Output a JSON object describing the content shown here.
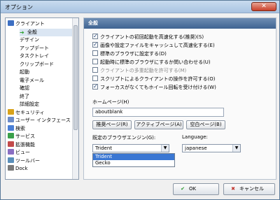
{
  "window": {
    "title": "オプション",
    "close_glyph": "✕"
  },
  "sidebar": {
    "items": [
      {
        "label": "クライアント",
        "level": 0,
        "icon": "client-icon",
        "color": "#3d6fc2"
      },
      {
        "label": "全般",
        "level": 1,
        "icon": "arrow-right-icon",
        "color": "#2aa02a",
        "selected": true
      },
      {
        "label": "デザイン",
        "level": 1
      },
      {
        "label": "アップデート",
        "level": 1
      },
      {
        "label": "タスクトレイ",
        "level": 1
      },
      {
        "label": "クリップボード",
        "level": 1
      },
      {
        "label": "起動",
        "level": 1
      },
      {
        "label": "電子メール",
        "level": 1
      },
      {
        "label": "確認",
        "level": 1
      },
      {
        "label": "終了",
        "level": 1
      },
      {
        "label": "詳細設定",
        "level": 1
      },
      {
        "label": "セキュリティ",
        "level": 0,
        "icon": "security-icon",
        "color": "#d8a21a"
      },
      {
        "label": "ユーザー インタフェース",
        "level": 0,
        "icon": "ui-icon",
        "color": "#6b8cc9"
      },
      {
        "label": "検索",
        "level": 0,
        "icon": "search-icon",
        "color": "#4a7fd6"
      },
      {
        "label": "サービス",
        "level": 0,
        "icon": "service-icon",
        "color": "#3aa04a"
      },
      {
        "label": "拡張機能",
        "level": 0,
        "icon": "extension-icon",
        "color": "#c24a4a"
      },
      {
        "label": "ビュー",
        "level": 0,
        "icon": "view-icon",
        "color": "#8a6ec2"
      },
      {
        "label": "ツールバー",
        "level": 0,
        "icon": "toolbar-icon",
        "color": "#5a8fba"
      },
      {
        "label": "Dock",
        "level": 0,
        "icon": "dock-icon",
        "color": "#7a7a7a"
      }
    ]
  },
  "panel": {
    "header": "全般",
    "checkboxes": [
      {
        "label": "クライアントの初回起動を高速化する(推奨)(S)",
        "checked": true,
        "enabled": true
      },
      {
        "label": "画像や設定ファイルをキャッシュして高速化する(E)",
        "checked": true,
        "enabled": true
      },
      {
        "label": "標準のブラウザに設定する(D)",
        "checked": false,
        "enabled": true
      },
      {
        "label": "起動時に標準のブラウザにするか問い合わせる(U)",
        "checked": false,
        "enabled": true
      },
      {
        "label": "クライアントの多重起動を許可する(M)",
        "checked": false,
        "enabled": false
      },
      {
        "label": "スクリプトによるクライアントの操作を許可する(O)",
        "checked": false,
        "enabled": true
      },
      {
        "label": "フォーカスがなくてもホイール回転を受け付ける(W)",
        "checked": true,
        "enabled": true
      }
    ],
    "homepage": {
      "label": "ホームページ(H)",
      "value": "aboutblank",
      "buttons": [
        "推奨ページ(R)",
        "アクティブページ(A)",
        "空白ページ(B)"
      ]
    },
    "engine": {
      "label": "既定のブラウザエンジン(G):",
      "selected": "Trident",
      "options": [
        "Trident",
        "Gecko"
      ]
    },
    "language": {
      "label": "Language:",
      "selected": "japanese"
    }
  },
  "footer": {
    "ok_label": "OK",
    "cancel_label": "キャンセル"
  },
  "colors": {
    "accent": "#3f6492",
    "selection": "#3a77d3"
  }
}
